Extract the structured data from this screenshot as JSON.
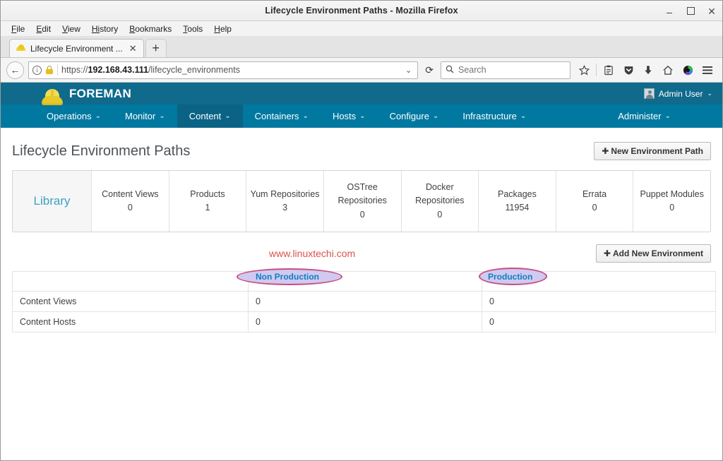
{
  "window": {
    "title": "Lifecycle Environment Paths - Mozilla Firefox",
    "minimize": "–",
    "maximize": "▫",
    "close": "✕"
  },
  "menubar": {
    "items": [
      {
        "label": "File",
        "accel": "F",
        "rest": "ile"
      },
      {
        "label": "Edit",
        "accel": "E",
        "rest": "dit"
      },
      {
        "label": "View",
        "accel": "V",
        "rest": "iew"
      },
      {
        "label": "History",
        "accel": "Hi",
        "rest": "story"
      },
      {
        "label": "Bookmarks",
        "accel": "B",
        "rest": "ookmarks"
      },
      {
        "label": "Tools",
        "accel": "T",
        "rest": "ools"
      },
      {
        "label": "Help",
        "accel": "H",
        "rest": "elp"
      }
    ]
  },
  "tabs": {
    "active_tab_title": "Lifecycle Environment ...",
    "close_glyph": "✕",
    "new_tab_glyph": "+",
    "favicon": "foreman-hardhat-icon"
  },
  "toolbar": {
    "back_glyph": "←",
    "info_glyph": "i",
    "url_prefix": "https://",
    "url_host": "192.168.43.111",
    "url_path": "/lifecycle_environments",
    "url_full": "https://192.168.43.111/lifecycle_environments",
    "dropdown_glyph": "⌄",
    "reload_glyph": "⟳",
    "search_placeholder": "Search",
    "search_value": "",
    "icons": [
      {
        "name": "bookmark-star-icon",
        "glyph": "☆"
      },
      {
        "name": "reading-list-icon",
        "glyph": "▤"
      },
      {
        "name": "pocket-shield-icon",
        "glyph": "⛉"
      },
      {
        "name": "downloads-icon",
        "glyph": "⬇"
      },
      {
        "name": "home-icon",
        "glyph": "⌂"
      },
      {
        "name": "sync-account-icon",
        "glyph": "●"
      },
      {
        "name": "hamburger-menu-icon",
        "glyph": "☰"
      }
    ]
  },
  "foreman": {
    "brand": "FOREMAN",
    "user": {
      "name": "Admin User",
      "caret": "⌄"
    },
    "nav": [
      {
        "label": "Operations",
        "caret": "⌄",
        "active": false
      },
      {
        "label": "Monitor",
        "caret": "⌄",
        "active": false
      },
      {
        "label": "Content",
        "caret": "⌄",
        "active": true
      },
      {
        "label": "Containers",
        "caret": "⌄",
        "active": false
      },
      {
        "label": "Hosts",
        "caret": "⌄",
        "active": false
      },
      {
        "label": "Configure",
        "caret": "⌄",
        "active": false
      },
      {
        "label": "Infrastructure",
        "caret": "⌄",
        "active": false
      }
    ],
    "nav_right": {
      "label": "Administer",
      "caret": "⌄"
    },
    "colors": {
      "header_bg": "#0f6a8b",
      "nav_bg": "#0078a0",
      "nav_active_bg": "#0a6385",
      "link": "#0088ce"
    }
  },
  "page": {
    "title": "Lifecycle Environment Paths",
    "new_environment_path_button": "New Environment Path",
    "plus_glyph": "✚",
    "add_new_environment_button": "Add New Environment",
    "watermark": "www.linuxtechi.com"
  },
  "library_panel": {
    "name": "Library",
    "metrics": [
      {
        "label": "Content Views",
        "value": "0"
      },
      {
        "label": "Products",
        "value": "1"
      },
      {
        "label": "Yum Repositories",
        "value": "3"
      },
      {
        "label": "OSTree Repositories",
        "value": "0"
      },
      {
        "label": "Docker Repositories",
        "value": "0"
      },
      {
        "label": "Packages",
        "value": "11954"
      },
      {
        "label": "Errata",
        "value": "0"
      },
      {
        "label": "Puppet Modules",
        "value": "0"
      }
    ]
  },
  "environments_table": {
    "columns": [
      "",
      "Non Production",
      "Production"
    ],
    "rows": [
      {
        "label": "Content Views",
        "values": [
          "0",
          "0"
        ]
      },
      {
        "label": "Content Hosts",
        "values": [
          "0",
          "0"
        ]
      }
    ]
  },
  "annotations": {
    "ellipse_border_color": "#c4457c",
    "ellipse_fill_color": "#cfc7f0",
    "highlighted": [
      "Non Production",
      "Production"
    ]
  }
}
